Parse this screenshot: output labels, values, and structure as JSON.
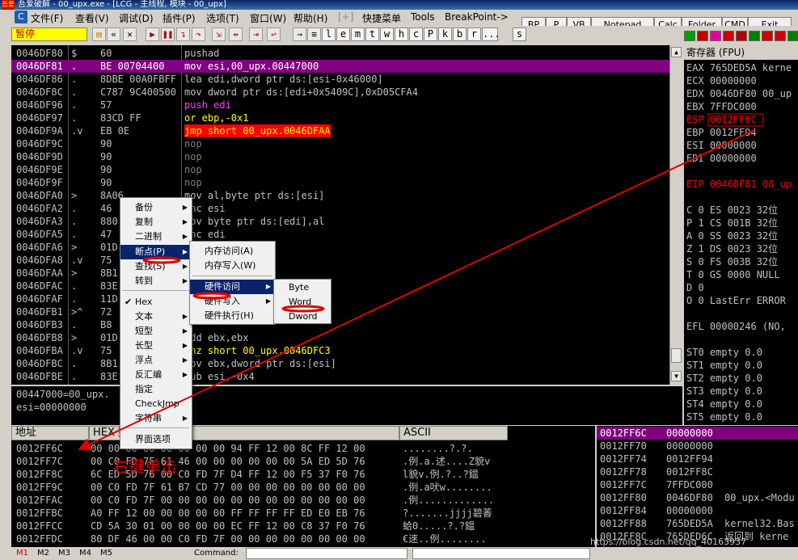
{
  "window": {
    "title": "吾爱破解 - 00_upx.exe - [LCG - 主线程, 模块 - 00_upx]",
    "logo_text": "吾爱"
  },
  "menu": {
    "items": [
      "文件(F)",
      "查看(V)",
      "调试(D)",
      "插件(P)",
      "选项(T)",
      "窗口(W)",
      "帮助(H)",
      "[+]",
      "快捷菜单",
      "Tools",
      "BreakPoint->"
    ],
    "right_buttons": [
      "BP",
      "P",
      "VB",
      "Notepad",
      "Calc",
      "Folder",
      "CMD",
      "Exit"
    ]
  },
  "toolbar": {
    "status": "暂停",
    "letters": [
      "l",
      "e",
      "m",
      "t",
      "w",
      "h",
      "c",
      "P",
      "k",
      "b",
      "r",
      "...",
      "s"
    ]
  },
  "cpu": {
    "rows": [
      {
        "addr": "0046DF80",
        "mark": "$",
        "hex": "60",
        "dis": "pushad"
      },
      {
        "addr": "0046DF81",
        "mark": ".",
        "hex": "BE 00704400",
        "dis": "mov esi,00_upx.00447000"
      },
      {
        "addr": "0046DF86",
        "mark": ".",
        "hex": "8DBE 00A0FBFF",
        "dis": "lea edi,dword ptr ds:[esi-0x46000]"
      },
      {
        "addr": "0046DF8C",
        "mark": ".",
        "hex": "C787 9C400500",
        "dis": "mov dword ptr ds:[edi+0x5409C],0xD05CFA4"
      },
      {
        "addr": "0046DF96",
        "mark": ".",
        "hex": "57",
        "dis": "push edi"
      },
      {
        "addr": "0046DF97",
        "mark": ".",
        "hex": "83CD FF",
        "dis": "or ebp,-0x1"
      },
      {
        "addr": "0046DF9A",
        "mark": ".v",
        "hex": "EB 0E",
        "dis": "jmp short 00_upx.0046DFAA"
      },
      {
        "addr": "0046DF9C",
        "mark": "",
        "hex": "90",
        "dis": "nop"
      },
      {
        "addr": "0046DF9D",
        "mark": "",
        "hex": "90",
        "dis": "nop"
      },
      {
        "addr": "0046DF9E",
        "mark": "",
        "hex": "90",
        "dis": "nop"
      },
      {
        "addr": "0046DF9F",
        "mark": "",
        "hex": "90",
        "dis": "nop"
      },
      {
        "addr": "0046DFA0",
        "mark": ">",
        "hex": "8A06",
        "dis": "mov al,byte ptr ds:[esi]"
      },
      {
        "addr": "0046DFA2",
        "mark": ".",
        "hex": "46",
        "dis": "inc esi"
      },
      {
        "addr": "0046DFA3",
        "mark": ".",
        "hex": "880",
        "dis": "mov byte ptr ds:[edi],al"
      },
      {
        "addr": "0046DFA5",
        "mark": ".",
        "hex": "47",
        "dis": "inc edi"
      },
      {
        "addr": "0046DFA6",
        "mark": ">",
        "hex": "01D",
        "dis": ""
      },
      {
        "addr": "0046DFA8",
        "mark": ".v",
        "hex": "75",
        "dis": "00_upx.0046DFB1"
      },
      {
        "addr": "0046DFAA",
        "mark": ">",
        "hex": "8B1",
        "dis": "ptr ds:[esi]"
      },
      {
        "addr": "0046DFAC",
        "mark": ".",
        "hex": "83E",
        "dis": ""
      },
      {
        "addr": "0046DFAF",
        "mark": ".",
        "hex": "11D",
        "dis": ""
      },
      {
        "addr": "0046DFB1",
        "mark": ">^",
        "hex": "72",
        "dis": "0"
      },
      {
        "addr": "0046DFB3",
        "mark": ".",
        "hex": "B8",
        "dis": ""
      },
      {
        "addr": "0046DFB8",
        "mark": ">",
        "hex": "01D",
        "dis": "add ebx,ebx"
      },
      {
        "addr": "0046DFBA",
        "mark": ".v",
        "hex": "75",
        "dis": "jnz short 00_upx.0046DFC3"
      },
      {
        "addr": "0046DFBC",
        "mark": ".",
        "hex": "8B1",
        "dis": "mov ebx,dword ptr ds:[esi]"
      },
      {
        "addr": "0046DFBE",
        "mark": ".",
        "hex": "83E",
        "dis": "sub esi,-0x4"
      }
    ],
    "info": [
      "00447000=00_upx.",
      "esi=00000000"
    ]
  },
  "registers": {
    "title": "寄存器 (FPU)",
    "lines": [
      "EAX 765DED5A kerne",
      "ECX 00000000",
      "EDX 0046DF80 00_up",
      "EBX 7FFDC000",
      "ESP 0012FF6C",
      "EBP 0012FF94",
      "ESI 00000000",
      "EDI 00000000",
      "",
      "EIP 0046DF81 00_up",
      "",
      "C 0  ES 0023 32位",
      "P 1  CS 001B 32位",
      "A 0  SS 0023 32位",
      "Z 1  DS 0023 32位",
      "S 0  FS 003B 32位",
      "T 0  GS 0000 NULL",
      "D 0",
      "O 0  LastErr ERROR",
      "",
      "EFL 00000246 (NO,",
      "",
      "ST0 empty 0.0",
      "ST1 empty 0.0",
      "ST2 empty 0.0",
      "ST3 empty 0.0",
      "ST4 empty 0.0",
      "ST5 empty 0.0",
      "ST6 empty 0.0",
      "ST7 empty 0.0"
    ]
  },
  "dump": {
    "headers": {
      "address": "地址",
      "hex": "HEX 数据",
      "ascii": "ASCII"
    },
    "rows": [
      {
        "addr": "0012FF6C",
        "hex": "00 00 00 00 00 00 00 00 94 FF 12 00 8C FF 12 00",
        "ascii": "........?.?."
      },
      {
        "addr": "0012FF7C",
        "hex": "00 C0 FD 7F 61 46 00 00 00 00 00 00 5A ED 5D 76",
        "ascii": ".例.a.述....Z貌v"
      },
      {
        "addr": "0012FF8C",
        "hex": "6C ED 5D 76 00 C0 FD 7F D4 FF 12 00 F5 37 F0 76",
        "ascii": "l貌v.例.?..?鎾"
      },
      {
        "addr": "0012FF9C",
        "hex": "00 C0 FD 7F 61 B7 CD 77 00 00 00 00 00 00 00 00",
        "ascii": ".例.a吠w........"
      },
      {
        "addr": "0012FFAC",
        "hex": "00 C0 FD 7F 00 00 00 00 00 00 00 00 00 00 00 00",
        "ascii": ".例............."
      },
      {
        "addr": "0012FFBC",
        "hex": "A0 FF 12 00 00 00 00 00 FF FF FF FF ED E0 EB 76",
        "ascii": "?.......jjjj碧萫"
      },
      {
        "addr": "0012FFCC",
        "hex": "CD 5A 30 01 00 00 00 00 EC FF 12 00 C8 37 F0 76",
        "ascii": "蛤0.....?.?鎾"
      },
      {
        "addr": "0012FFDC",
        "hex": "80 DF 46 00 00 C0 FD 7F 00 00 00 00 00 00 00 00",
        "ascii": "€逨..例........"
      }
    ]
  },
  "stack": {
    "rows": [
      {
        "addr": "0012FF6C",
        "value": "00000000",
        "comment": ""
      },
      {
        "addr": "0012FF70",
        "value": "00000000",
        "comment": ""
      },
      {
        "addr": "0012FF74",
        "value": "0012FF94",
        "comment": ""
      },
      {
        "addr": "0012FF78",
        "value": "0012FF8C",
        "comment": ""
      },
      {
        "addr": "0012FF7C",
        "value": "7FFDC000",
        "comment": ""
      },
      {
        "addr": "0012FF80",
        "value": "0046DF80",
        "comment": "00_upx.<Modu"
      },
      {
        "addr": "0012FF84",
        "value": "00000000",
        "comment": ""
      },
      {
        "addr": "0012FF88",
        "value": "765DED5A",
        "comment": "kernel32.Bas"
      },
      {
        "addr": "0012FF8C",
        "value": "765DED6C",
        "comment": "返回到 kerne"
      }
    ]
  },
  "context_menu": {
    "items": [
      "备份",
      "复制",
      "二进制",
      "断点(P)",
      "查找(S)",
      "转到",
      "Hex",
      "文本",
      "短型",
      "长型",
      "浮点",
      "反汇编",
      "指定",
      "CheckJmp",
      "字符串",
      "界面选项"
    ],
    "breakpoint_submenu": [
      "内存访问(A)",
      "内存写入(W)",
      "硬件访问",
      "硬件写入",
      "硬件执行(H)"
    ],
    "hardware_submenu": [
      "Byte",
      "Word",
      "Dword"
    ]
  },
  "annotation": "右键单击",
  "statusbar": {
    "tabs": [
      "M1",
      "M2",
      "M3",
      "M4",
      "M5"
    ],
    "command_label": "Command:"
  },
  "watermark": "https://blog.csdn.net/qq_40163937",
  "colors": {
    "selection": "#800080",
    "highlight": "#ff0000",
    "accent": "#0a246a"
  }
}
